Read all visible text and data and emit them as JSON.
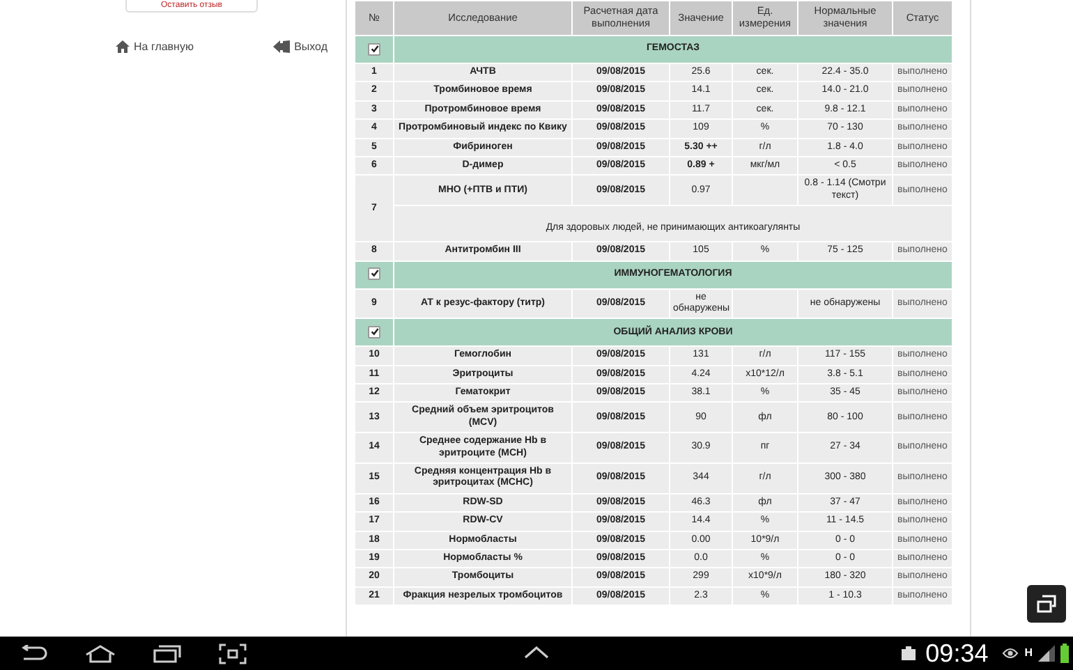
{
  "sidebar": {
    "feedback_button": "Оставить отзыв",
    "links": [
      {
        "kind": "home",
        "label": "На главную"
      },
      {
        "kind": "exit",
        "label": "Выход"
      }
    ]
  },
  "table": {
    "columns": [
      "№",
      "Исследование",
      "Расчетная дата выполнения",
      "Значение",
      "Ед. измерения",
      "Нормальные значения",
      "Статус"
    ],
    "sections": [
      {
        "title": "ГЕМОСТАЗ",
        "checked": true,
        "rows": [
          {
            "number": "1",
            "name": "АЧТВ",
            "date": "09/08/2015",
            "value": "25.6",
            "abnormal": false,
            "unit": "сек.",
            "normal": "22.4 - 35.0",
            "status": "выполнено"
          },
          {
            "number": "2",
            "name": "Тромбиновое время",
            "date": "09/08/2015",
            "value": "14.1",
            "abnormal": false,
            "unit": "сек.",
            "normal": "14.0 - 21.0",
            "status": "выполнено"
          },
          {
            "number": "3",
            "name": "Протромбиновое время",
            "date": "09/08/2015",
            "value": "11.7",
            "abnormal": false,
            "unit": "сек.",
            "normal": "9.8 - 12.1",
            "status": "выполнено"
          },
          {
            "number": "4",
            "name": "Протромбиновый индекс по Квику",
            "date": "09/08/2015",
            "value": "109",
            "abnormal": false,
            "unit": "%",
            "normal": "70 - 130",
            "status": "выполнено"
          },
          {
            "number": "5",
            "name": "Фибриноген",
            "date": "09/08/2015",
            "value": "5.30 ++",
            "abnormal": true,
            "unit": "г/л",
            "normal": "1.8 - 4.0",
            "status": "выполнено"
          },
          {
            "number": "6",
            "name": "D-димер",
            "date": "09/08/2015",
            "value": "0.89 +",
            "abnormal": true,
            "unit": "мкг/мл",
            "normal": "< 0.5",
            "status": "выполнено"
          },
          {
            "number": "7",
            "name": "МНО (+ПТВ и ПТИ)",
            "date": "09/08/2015",
            "value": "0.97",
            "abnormal": false,
            "normal": "0.8 - 1.14 (Смотри текст)",
            "status": "выполнено",
            "note": "Для здоровых людей, не принимающих антикоагулянты"
          },
          {
            "number": "8",
            "name": "Антитромбин III",
            "date": "09/08/2015",
            "value": "105",
            "abnormal": false,
            "unit": "%",
            "normal": "75 - 125",
            "status": "выполнено"
          }
        ]
      },
      {
        "title": "ИММУНОГЕМАТОЛОГИЯ",
        "checked": true,
        "rows": [
          {
            "number": "9",
            "name": "АТ к резус-фактору (титр)",
            "date": "09/08/2015",
            "value": "не обнаружены",
            "abnormal": false,
            "normal": "не обнаружены",
            "status": "выполнено"
          }
        ]
      },
      {
        "title": "ОБЩИЙ АНАЛИЗ КРОВИ",
        "checked": true,
        "rows": [
          {
            "number": "10",
            "name": "Гемоглобин",
            "date": "09/08/2015",
            "value": "131",
            "abnormal": false,
            "unit": "г/л",
            "normal": "117 - 155",
            "status": "выполнено"
          },
          {
            "number": "11",
            "name": "Эритроциты",
            "date": "09/08/2015",
            "value": "4.24",
            "abnormal": false,
            "unit": "x10*12/л",
            "normal": "3.8 - 5.1",
            "status": "выполнено"
          },
          {
            "number": "12",
            "name": "Гематокрит",
            "date": "09/08/2015",
            "value": "38.1",
            "abnormal": false,
            "unit": "%",
            "normal": "35 - 45",
            "status": "выполнено"
          },
          {
            "number": "13",
            "name": "Средний объем эритроцитов (MCV)",
            "date": "09/08/2015",
            "value": "90",
            "abnormal": false,
            "unit": "фл",
            "normal": "80 - 100",
            "status": "выполнено"
          },
          {
            "number": "14",
            "name": "Среднее содержание Hb в эритроците (MCH)",
            "date": "09/08/2015",
            "value": "30.9",
            "abnormal": false,
            "unit": "пг",
            "normal": "27 - 34",
            "status": "выполнено"
          },
          {
            "number": "15",
            "name": "Средняя концентрация Hb в эритроцитах (MCHC)",
            "date": "09/08/2015",
            "value": "344",
            "abnormal": false,
            "unit": "г/л",
            "normal": "300 - 380",
            "status": "выполнено"
          },
          {
            "number": "16",
            "name": "RDW-SD",
            "date": "09/08/2015",
            "value": "46.3",
            "abnormal": false,
            "unit": "фл",
            "normal": "37 - 47",
            "status": "выполнено"
          },
          {
            "number": "17",
            "name": "RDW-CV",
            "date": "09/08/2015",
            "value": "14.4",
            "abnormal": false,
            "unit": "%",
            "normal": "11 - 14.5",
            "status": "выполнено"
          },
          {
            "number": "18",
            "name": "Нормобласты",
            "date": "09/08/2015",
            "value": "0.00",
            "abnormal": false,
            "unit": "10*9/л",
            "normal": "0 - 0",
            "status": "выполнено"
          },
          {
            "number": "19",
            "name": "Нормобласты %",
            "date": "09/08/2015",
            "value": "0.0",
            "abnormal": false,
            "unit": "%",
            "normal": "0 - 0",
            "status": "выполнено"
          },
          {
            "number": "20",
            "name": "Тромбоциты",
            "date": "09/08/2015",
            "value": "299",
            "abnormal": false,
            "unit": "x10*9/л",
            "normal": "180 - 320",
            "status": "выполнено"
          },
          {
            "number": "21",
            "name": "Фракция незрелых тромбоцитов",
            "date": "09/08/2015",
            "value": "2.3",
            "abnormal": false,
            "unit": "%",
            "normal": "1 - 10.3",
            "status": "выполнено"
          }
        ]
      }
    ]
  },
  "status_bar": {
    "time": "09:34",
    "network": "H"
  }
}
